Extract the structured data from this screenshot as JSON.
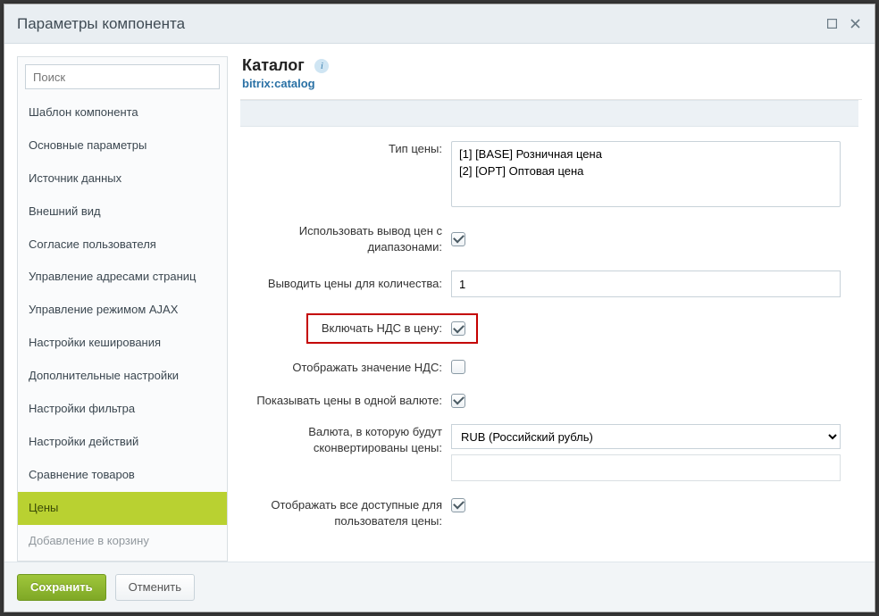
{
  "window": {
    "title": "Параметры компонента"
  },
  "sidebar": {
    "search_placeholder": "Поиск",
    "items": [
      {
        "label": "Шаблон компонента"
      },
      {
        "label": "Основные параметры"
      },
      {
        "label": "Источник данных"
      },
      {
        "label": "Внешний вид"
      },
      {
        "label": "Согласие пользователя"
      },
      {
        "label": "Управление адресами страниц"
      },
      {
        "label": "Управление режимом AJAX"
      },
      {
        "label": "Настройки кеширования"
      },
      {
        "label": "Дополнительные настройки"
      },
      {
        "label": "Настройки фильтра"
      },
      {
        "label": "Настройки действий"
      },
      {
        "label": "Сравнение товаров"
      },
      {
        "label": "Цены",
        "active": true
      },
      {
        "label": "Добавление в корзину",
        "cut": true
      }
    ]
  },
  "header": {
    "title": "Каталог",
    "subtitle": "bitrix:catalog",
    "info_char": "i"
  },
  "form": {
    "price_type": {
      "label": "Тип цены:",
      "options": [
        "[1] [BASE] Розничная цена",
        "[2] [OPT] Оптовая цена"
      ]
    },
    "use_price_ranges": {
      "label": "Использовать вывод цен с диапазонами:",
      "checked": true
    },
    "show_price_count": {
      "label": "Выводить цены для количества:",
      "value": "1"
    },
    "include_vat": {
      "label": "Включать НДС в цену:",
      "checked": true
    },
    "show_vat": {
      "label": "Отображать значение НДС:",
      "checked": false
    },
    "single_currency": {
      "label": "Показывать цены в одной валюте:",
      "checked": true
    },
    "convert_currency": {
      "label": "Валюта, в которую будут сконвертированы цены:",
      "value": "RUB (Российский рубль)"
    },
    "show_all_user_prices": {
      "label": "Отображать все доступные для пользователя цены:",
      "checked": true
    }
  },
  "footer": {
    "save": "Сохранить",
    "cancel": "Отменить"
  }
}
